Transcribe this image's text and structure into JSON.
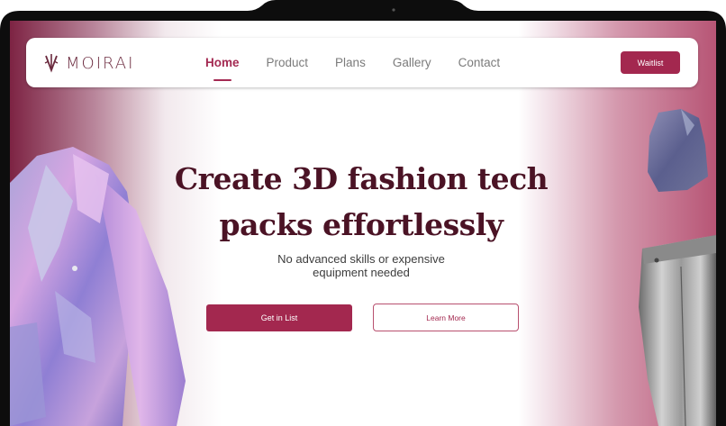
{
  "brand": {
    "name": "MOIRAI"
  },
  "nav": {
    "links": [
      {
        "label": "Home",
        "active": true
      },
      {
        "label": "Product",
        "active": false
      },
      {
        "label": "Plans",
        "active": false
      },
      {
        "label": "Gallery",
        "active": false
      },
      {
        "label": "Contact",
        "active": false
      }
    ],
    "cta_label": "Waitlist"
  },
  "hero": {
    "title_line1": "Create 3D fashion tech",
    "title_line2": "packs effortlessly",
    "subtitle_line1": "No advanced skills or expensive",
    "subtitle_line2": "equipment needed",
    "primary_label": "Get in List",
    "secondary_label": "Learn More"
  },
  "colors": {
    "accent": "#a3284f",
    "title": "#4b1325",
    "bezel": "#0d0d0d"
  }
}
